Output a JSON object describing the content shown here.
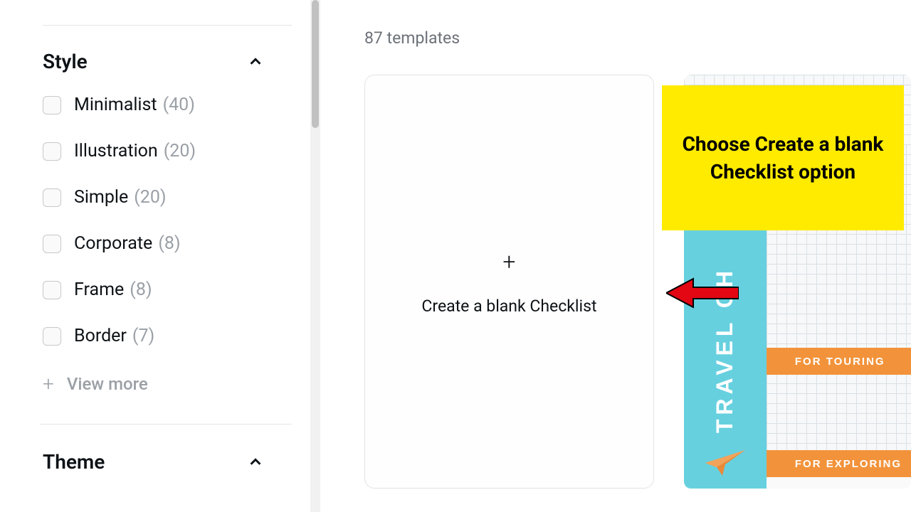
{
  "sidebar": {
    "section1_title": "Style",
    "section2_title": "Theme",
    "options": [
      {
        "label": "Minimalist",
        "count": "(40)"
      },
      {
        "label": "Illustration",
        "count": "(20)"
      },
      {
        "label": "Simple",
        "count": "(20)"
      },
      {
        "label": "Corporate",
        "count": "(8)"
      },
      {
        "label": "Frame",
        "count": "(8)"
      },
      {
        "label": "Border",
        "count": "(7)"
      }
    ],
    "view_more": "View more"
  },
  "main": {
    "count_label": "87 templates",
    "blank_label": "Create a blank Checklist"
  },
  "template2": {
    "vertical_text": "TRAVEL CH",
    "tag1": "FOR TOURING",
    "tag2": "FOR EXPLORING"
  },
  "callout": {
    "text": "Choose Create a blank Checklist option"
  }
}
